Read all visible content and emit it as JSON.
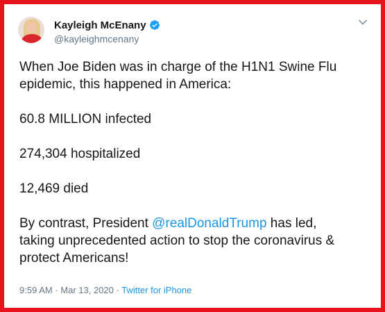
{
  "tweet": {
    "author_name": "Kayleigh McEnany",
    "handle": "@kayleighmcenany",
    "verified": true,
    "line1": "When Joe Biden was in charge of the H1N1 Swine Flu",
    "line2": "epidemic, this happened in America:",
    "stat_infected": "60.8 MILLION infected",
    "stat_hospitalized": "274,304 hospitalized",
    "stat_died": "12,469 died",
    "contrast_prefix": "By contrast, President ",
    "mention": "@realDonaldTrump",
    "contrast_suffix": " has led,",
    "line_taking": "taking unprecedented action to stop the coronavirus &",
    "line_protect": "protect Americans!",
    "time": "9:59 AM",
    "separator": " · ",
    "date": "Mar 13, 2020",
    "source": "Twitter for iPhone"
  },
  "colors": {
    "frame_border": "#e8141b",
    "link": "#1b95e0",
    "text": "#14171a",
    "secondary": "#657786"
  },
  "icons": {
    "verified": "verified-badge-icon",
    "menu": "chevron-down-icon"
  }
}
